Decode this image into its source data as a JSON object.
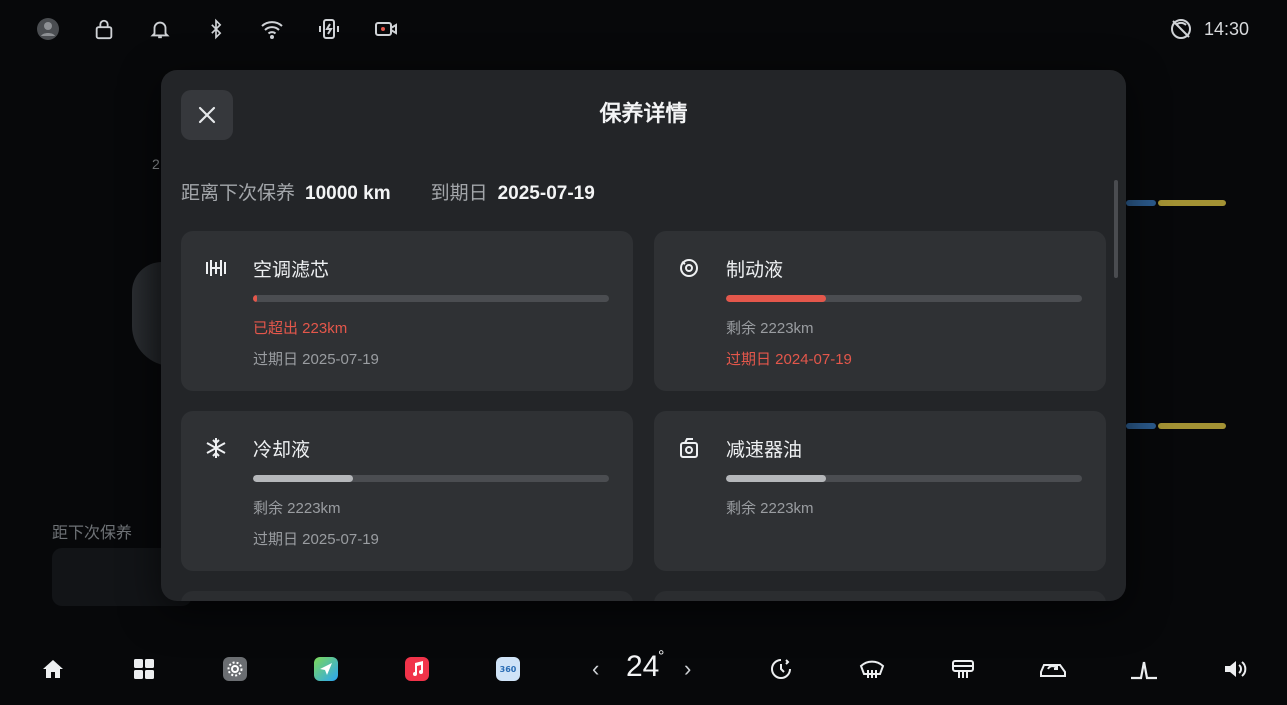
{
  "status_bar": {
    "time": "14:30",
    "icons": [
      "profile-icon",
      "lock-icon",
      "bell-icon",
      "bluetooth-icon",
      "wifi-icon",
      "charging-icon",
      "dashcam-icon",
      "no-signal-icon"
    ]
  },
  "background": {
    "partial_number": "2",
    "next_service_label": "距下次保养"
  },
  "modal": {
    "title": "保养详情",
    "summary": {
      "distance_label": "距离下次保养",
      "distance_value": "10000 km",
      "due_label": "到期日",
      "due_value": "2025-07-19"
    },
    "items": [
      {
        "name": "空调滤芯",
        "icon": "ac-filter-icon",
        "progress": 0.01,
        "bar_color": "#e4574b",
        "line1": "已超出 223km",
        "line1_alert": true,
        "line2": "过期日 2025-07-19",
        "line2_alert": false
      },
      {
        "name": "制动液",
        "icon": "brake-fluid-icon",
        "progress": 0.28,
        "bar_color": "#e4574b",
        "line1": "剩余 2223km",
        "line1_alert": false,
        "line2": "过期日 2024-07-19",
        "line2_alert": true
      },
      {
        "name": "冷却液",
        "icon": "snowflake-icon",
        "progress": 0.28,
        "bar_color": "#b5b7ba",
        "line1": "剩余 2223km",
        "line1_alert": false,
        "line2": "过期日 2025-07-19",
        "line2_alert": false
      },
      {
        "name": "减速器油",
        "icon": "reducer-oil-icon",
        "progress": 0.28,
        "bar_color": "#b5b7ba",
        "line1": "剩余 2223km",
        "line1_alert": false,
        "line2": "",
        "line2_alert": false
      }
    ]
  },
  "dock": {
    "temperature": "24",
    "temperature_unit": "°",
    "icons": [
      "home-icon",
      "apps-grid-icon",
      "settings-app-icon",
      "navigation-app-icon",
      "music-app-icon",
      "camera-360-app-icon",
      "temp-down-chevron-icon",
      "temp-up-chevron-icon",
      "fan-icon",
      "front-defrost-icon",
      "rear-defrost-icon",
      "car-recirculation-icon",
      "seat-icon",
      "volume-icon"
    ],
    "colors": {
      "music": "#f1334a",
      "navigation": "#2aa5f5",
      "settings": "#6b6e72",
      "camera": "#cfe3f7"
    }
  }
}
